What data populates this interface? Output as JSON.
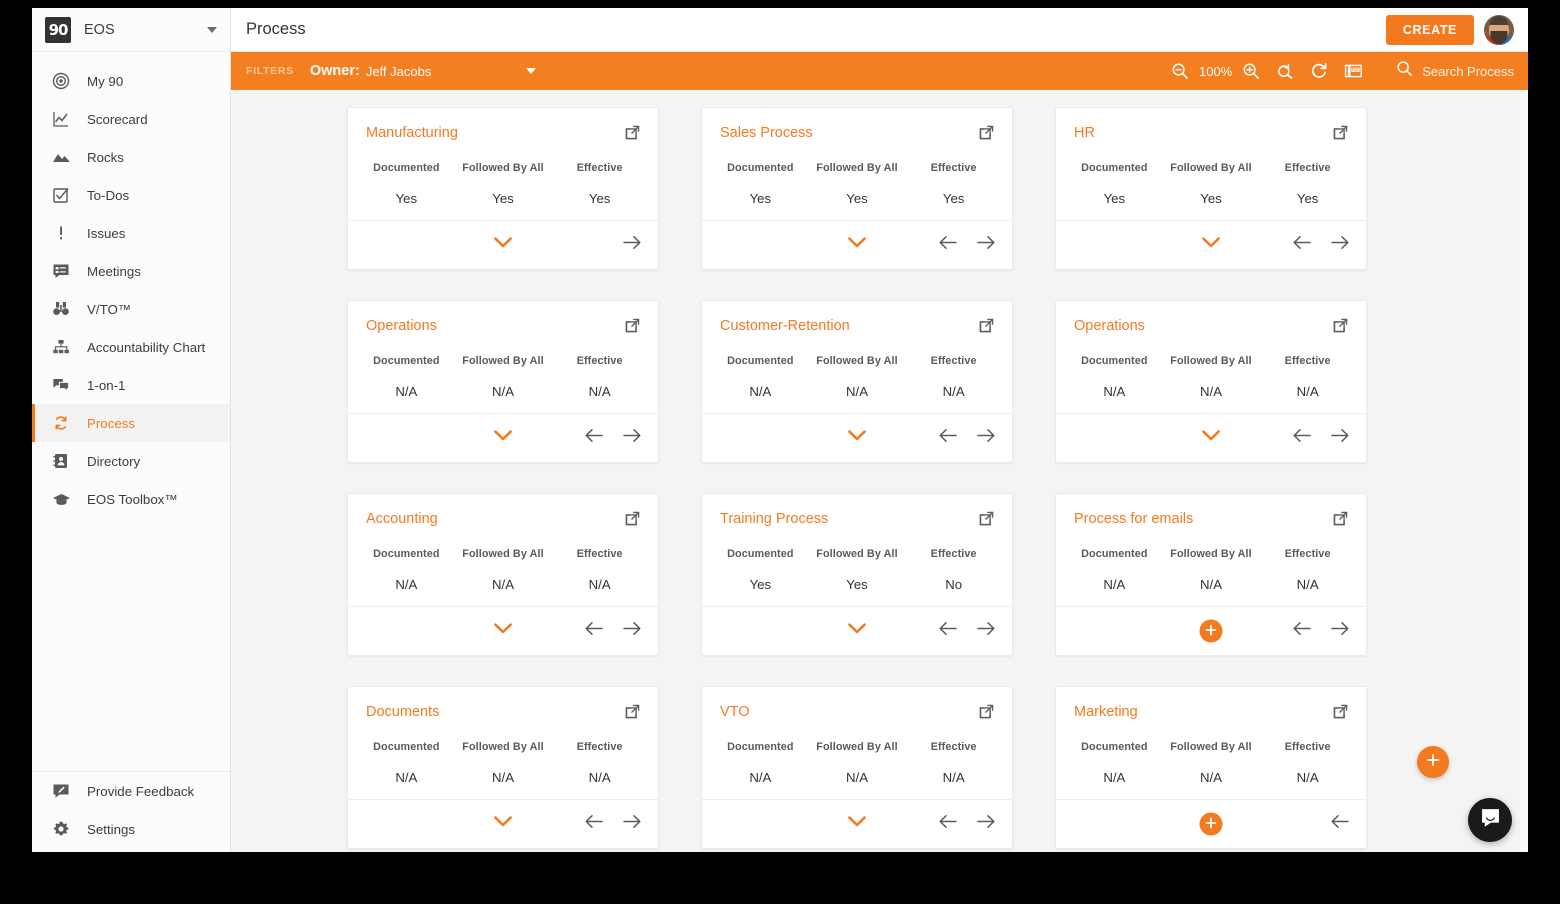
{
  "brand": {
    "logo_text": "90",
    "name": "EOS",
    "caret_icon": "chevron-down-icon"
  },
  "sidebar": {
    "items": [
      {
        "label": "My 90",
        "icon": "target-icon",
        "active": false
      },
      {
        "label": "Scorecard",
        "icon": "line-chart-icon",
        "active": false
      },
      {
        "label": "Rocks",
        "icon": "mountain-icon",
        "active": false
      },
      {
        "label": "To-Dos",
        "icon": "checkbox-icon",
        "active": false
      },
      {
        "label": "Issues",
        "icon": "exclamation-icon",
        "active": false
      },
      {
        "label": "Meetings",
        "icon": "meeting-board-icon",
        "active": false
      },
      {
        "label": "V/TO™",
        "icon": "binoculars-icon",
        "active": false
      },
      {
        "label": "Accountability Chart",
        "icon": "org-chart-icon",
        "active": false
      },
      {
        "label": "1-on-1",
        "icon": "chat-bubbles-icon",
        "active": false
      },
      {
        "label": "Process",
        "icon": "refresh-cycle-icon",
        "active": true
      },
      {
        "label": "Directory",
        "icon": "contact-card-icon",
        "active": false
      },
      {
        "label": "EOS Toolbox™",
        "icon": "graduation-cap-icon",
        "active": false
      }
    ],
    "bottom_items": [
      {
        "label": "Provide Feedback",
        "icon": "feedback-icon"
      },
      {
        "label": "Settings",
        "icon": "gear-icon"
      }
    ]
  },
  "header": {
    "title": "Process",
    "create_label": "CREATE",
    "avatar_name": "user-avatar"
  },
  "filters": {
    "label": "FILTERS",
    "owner_label": "Owner:",
    "owner_value": "Jeff Jacobs",
    "caret_icon": "chevron-down-icon",
    "zoom_out_icon": "zoom-out-icon",
    "zoom_level": "100%",
    "zoom_in_icon": "zoom-in-icon",
    "zoom_reset_icon": "zoom-reset-icon",
    "refresh_icon": "refresh-icon",
    "pdf_icon": "pdf-export-icon",
    "search_icon": "search-icon",
    "search_placeholder": "Search Process"
  },
  "card_columns": [
    "Documented",
    "Followed By All",
    "Effective"
  ],
  "cards": [
    {
      "title": "Manufacturing",
      "values": [
        "Yes",
        "Yes",
        "Yes"
      ],
      "footer_center": "chevron",
      "prev": false,
      "next": true
    },
    {
      "title": "Sales Process",
      "values": [
        "Yes",
        "Yes",
        "Yes"
      ],
      "footer_center": "chevron",
      "prev": true,
      "next": true
    },
    {
      "title": "HR",
      "values": [
        "Yes",
        "Yes",
        "Yes"
      ],
      "footer_center": "chevron",
      "prev": true,
      "next": true
    },
    {
      "title": "Operations",
      "values": [
        "N/A",
        "N/A",
        "N/A"
      ],
      "footer_center": "chevron",
      "prev": true,
      "next": true
    },
    {
      "title": "Customer-Retention",
      "values": [
        "N/A",
        "N/A",
        "N/A"
      ],
      "footer_center": "chevron",
      "prev": true,
      "next": true
    },
    {
      "title": "Operations",
      "values": [
        "N/A",
        "N/A",
        "N/A"
      ],
      "footer_center": "chevron",
      "prev": true,
      "next": true
    },
    {
      "title": "Accounting",
      "values": [
        "N/A",
        "N/A",
        "N/A"
      ],
      "footer_center": "chevron",
      "prev": true,
      "next": true
    },
    {
      "title": "Training Process",
      "values": [
        "Yes",
        "Yes",
        "No"
      ],
      "footer_center": "chevron",
      "prev": true,
      "next": true
    },
    {
      "title": "Process for emails",
      "values": [
        "N/A",
        "N/A",
        "N/A"
      ],
      "footer_center": "plus",
      "prev": true,
      "next": true
    },
    {
      "title": "Documents",
      "values": [
        "N/A",
        "N/A",
        "N/A"
      ],
      "footer_center": "chevron",
      "prev": true,
      "next": true
    },
    {
      "title": "VTO",
      "values": [
        "N/A",
        "N/A",
        "N/A"
      ],
      "footer_center": "chevron",
      "prev": true,
      "next": true
    },
    {
      "title": "Marketing",
      "values": [
        "N/A",
        "N/A",
        "N/A"
      ],
      "footer_center": "plus",
      "prev": true,
      "next": false
    }
  ],
  "floating": {
    "add_label": "+",
    "add_icon": "plus-icon",
    "chat_icon": "intercom-chat-icon"
  },
  "colors": {
    "accent": "#f47a20",
    "filters_bar": "#f47f20",
    "page_bg": "#f4f4f4",
    "card_bg": "#ffffff"
  }
}
